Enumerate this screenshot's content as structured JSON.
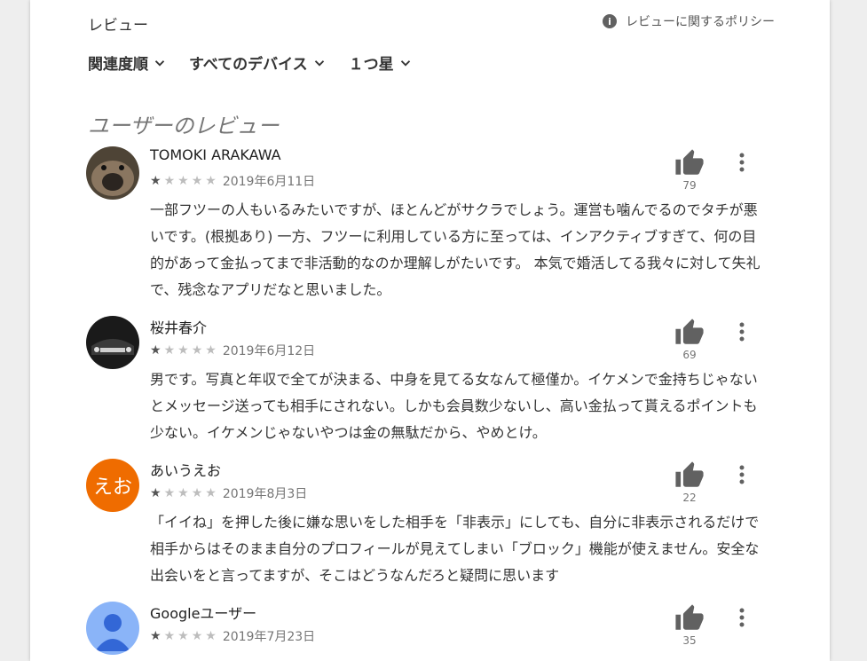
{
  "header": {
    "title": "レビュー",
    "policy_label": "レビューに関するポリシー",
    "policy_icon": "info-icon"
  },
  "filters": [
    {
      "label": "関連度順"
    },
    {
      "label": "すべてのデバイス"
    },
    {
      "label": "１つ星"
    }
  ],
  "section_title": "ユーザーのレビュー",
  "reviews": [
    {
      "author": "TOMOKI ARAKAWA",
      "stars": 1,
      "date": "2019年6月11日",
      "likes": "79",
      "text": "一部フツーの人もいるみたいですが、ほとんどがサクラでしょう。運営も噛んでるのでタチが悪いです。(根拠あり) 一方、フツーに利用している方に至っては、インアクティブすぎて、何の目的があって金払ってまで非活動的なのか理解しがたいです。 本気で婚活してる我々に対して失礼で、残念なアプリだなと思いました。"
    },
    {
      "author": "桜井春介",
      "stars": 1,
      "date": "2019年6月12日",
      "likes": "69",
      "text": "男です。写真と年収で全てが決まる、中身を見てる女なんて極僅か。イケメンで金持ちじゃないとメッセージ送っても相手にされない。しかも会員数少ないし、高い金払って貰えるポイントも少ない。イケメンじゃないやつは金の無駄だから、やめとけ。"
    },
    {
      "author": "あいうえお",
      "avatar_text": "えお",
      "stars": 1,
      "date": "2019年8月3日",
      "likes": "22",
      "text": "「イイね」を押した後に嫌な思いをした相手を「非表示」にしても、自分に非表示されるだけで相手からはそのまま自分のプロフィールが見えてしまい「ブロック」機能が使えません。安全な出会いをと言ってますが、そこはどうなんだろと疑問に思います"
    },
    {
      "author": "Googleユーザー",
      "stars": 1,
      "date": "2019年7月23日",
      "likes": "35",
      "text": ""
    }
  ],
  "colors": {
    "avatar_orange": "#ef6c00",
    "avatar_blue": "#8ab4f8",
    "icon_gray": "#616161"
  }
}
